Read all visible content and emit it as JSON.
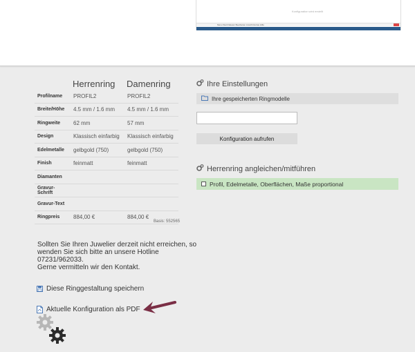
{
  "mini_screenshot": {
    "caption": "Konfiguration wird erstellt",
    "taskbar_text": "Menu  Start  Dateien  Bearbeiten  Ansicht  Extras  Hilfe"
  },
  "table": {
    "headers": [
      "Herrenring",
      "Damenring"
    ],
    "rows": [
      {
        "label": "Profilname",
        "herren": "PROFIL2",
        "damen": "PROFIL2"
      },
      {
        "label": "Breite/Höhe",
        "herren": "4.5 mm / 1.6 mm",
        "damen": "4.5 mm / 1.6 mm"
      },
      {
        "label": "Ringweite",
        "herren": "62 mm",
        "damen": "57 mm"
      },
      {
        "label": "Design",
        "herren": "Klassisch einfarbig",
        "damen": "Klassisch einfarbig"
      },
      {
        "label": "Edelmetalle",
        "herren": "gelbgold (750)",
        "damen": "gelbgold (750)"
      },
      {
        "label": "Finish",
        "herren": "feinmatt",
        "damen": "feinmatt"
      },
      {
        "label": "Diamanten",
        "herren": "",
        "damen": ""
      },
      {
        "label": "Gravur-Schrift",
        "herren": "",
        "damen": ""
      },
      {
        "label": "Gravur-Text",
        "herren": "",
        "damen": ""
      },
      {
        "label": "Ringpreis",
        "herren": "884,00 €",
        "damen": "884,00 €"
      }
    ],
    "basis": "Basis: 552565"
  },
  "info_lines": [
    "Sollten Sie Ihren Juwelier derzeit nicht erreichen, so",
    "wenden Sie sich bitte an unsere Hotline",
    "07231/962033.",
    "Gerne vermitteln wir den Kontakt."
  ],
  "links": {
    "save": "Diese Ringgestaltung speichern",
    "pdf": "Aktuelle Konfiguration als PDF"
  },
  "settings": {
    "title": "Ihre Einstellungen",
    "saved_models": "Ihre gespeicherten Ringmodelle",
    "input_value": "",
    "button": "Konfiguration aufrufen"
  },
  "adjust": {
    "title": "Herrenring angleichen/mitführen",
    "option": "Profil, Edelmetalle, Oberflächen, Maße proportional"
  },
  "colors": {
    "arrow": "#7a2e45",
    "green": "#c9e5c3",
    "accent_icon": "#4a78b5"
  }
}
